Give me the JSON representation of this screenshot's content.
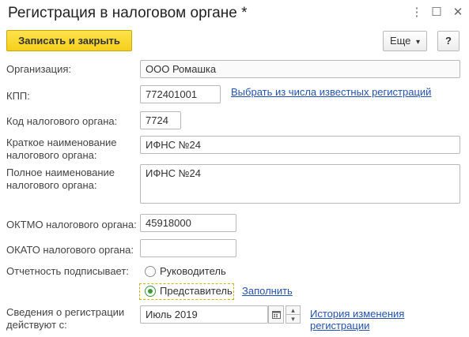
{
  "window": {
    "title": "Регистрация в налоговом органе *",
    "more_glyph": "⋮",
    "maximize_glyph": "☐",
    "close_glyph": "✕"
  },
  "toolbar": {
    "save_close_label": "Записать и закрыть",
    "more_label": "Еще",
    "more_arrow": "▾",
    "help_label": "?"
  },
  "form": {
    "organization": {
      "label": "Организация:",
      "value": "ООО Ромашка"
    },
    "kpp": {
      "label": "КПП:",
      "value": "772401001",
      "link": "Выбрать из числа известных регистраций"
    },
    "tax_code": {
      "label": "Код налогового органа:",
      "value": "7724"
    },
    "short_name": {
      "label_line1": "Краткое наименование",
      "label_line2": "налогового органа:",
      "value": "ИФНС №24"
    },
    "full_name": {
      "label_line1": "Полное наименование",
      "label_line2": "налогового органа:",
      "value": "ИФНС №24"
    },
    "oktmo": {
      "label": "ОКТМО налогового органа:",
      "value": "45918000"
    },
    "okato": {
      "label": "ОКАТО налогового органа:",
      "value": ""
    },
    "signer": {
      "label": "Отчетность подписывает:",
      "options": [
        "Руководитель",
        "Представитель"
      ],
      "selected": "Представитель",
      "fill_link": "Заполнить"
    },
    "registration": {
      "label_line1": "Сведения о регистрации",
      "label_line2": "действуют с:",
      "value": "Июль 2019",
      "history_link_line1": "История изменения",
      "history_link_line2": "регистрации"
    }
  },
  "icons": {
    "calendar": "calendar-icon",
    "stepper_up": "▴",
    "stepper_down": "▾"
  },
  "colors": {
    "primary_button": "#f5cf1b",
    "link": "#2352b1",
    "radio_selected": "#3c9a3c"
  }
}
